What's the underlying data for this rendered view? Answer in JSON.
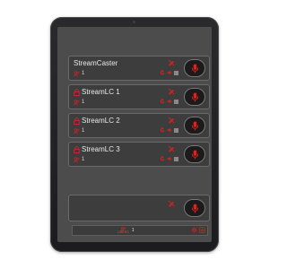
{
  "app": {
    "stations": [
      {
        "name": "StreamCaster",
        "locked": false,
        "users": "1"
      },
      {
        "name": "StreamLC 1",
        "locked": true,
        "users": "1"
      },
      {
        "name": "StreamLC 2",
        "locked": true,
        "users": "1"
      },
      {
        "name": "StreamLC 3",
        "locked": true,
        "users": "1"
      }
    ],
    "status_bar": {
      "users_label": "USERS",
      "users_count": "1"
    }
  },
  "colors": {
    "accent": "#e02020",
    "card_bg": "#3d3d3d",
    "screen_bg": "#4c4c4c"
  },
  "icons": [
    "lock-icon",
    "user-icon",
    "edit-off-icon",
    "refresh-icon",
    "speaker-icon",
    "mic-icon",
    "settings-icon",
    "power-icon"
  ]
}
